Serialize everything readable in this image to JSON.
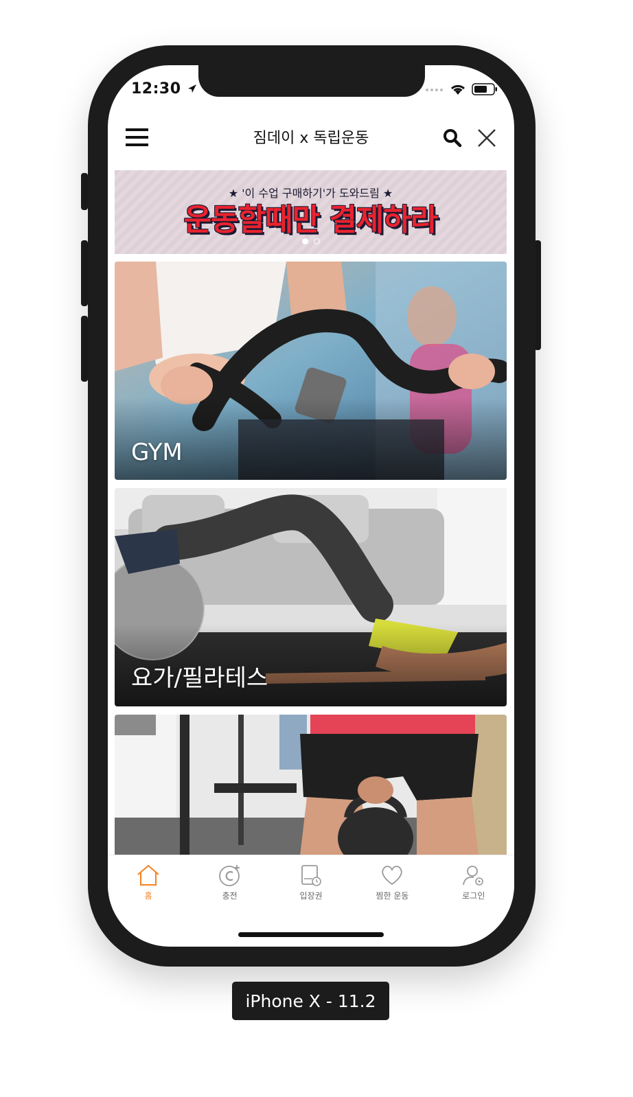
{
  "status_bar": {
    "time": "12:30"
  },
  "navbar": {
    "title": "짐데이 x 독립운동",
    "menu_icon": "hamburger-icon",
    "search_icon": "search-icon",
    "close_icon": "close-icon"
  },
  "banner": {
    "subtitle": "★ '이 수업 구매하기'가 도와드림 ★",
    "headline": "운동할때만 결제하라",
    "slides_total": 2,
    "slide_active": 1
  },
  "categories": [
    {
      "label": "GYM"
    },
    {
      "label": "요가/필라테스"
    },
    {
      "label": ""
    }
  ],
  "tabbar": {
    "items": [
      {
        "label": "홈",
        "icon": "home-icon",
        "active": true
      },
      {
        "label": "충전",
        "icon": "charge-icon",
        "active": false
      },
      {
        "label": "입장권",
        "icon": "ticket-icon",
        "active": false
      },
      {
        "label": "찜한 운동",
        "icon": "heart-icon",
        "active": false
      },
      {
        "label": "로그인",
        "icon": "user-icon",
        "active": false
      }
    ]
  },
  "colors": {
    "accent": "#f58220",
    "banner_red": "#e8232f",
    "frame": "#1c1c1c"
  },
  "device_label": "iPhone X - 11.2"
}
